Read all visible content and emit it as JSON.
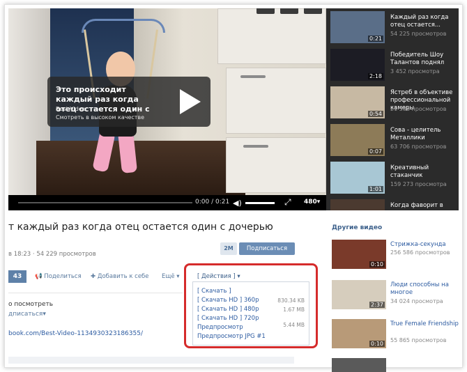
{
  "player": {
    "overlay_title": "Это происходит каждый раз когда отец остается один с",
    "overlay_channel": "Best Video",
    "overlay_hq": "Смотреть в высоком качестве",
    "time": "0:00 / 0:21",
    "quality": "480"
  },
  "playlist": [
    {
      "title": "Каждый раз когда отец остается...",
      "views": "54 225 просмотров",
      "duration": "0:21",
      "color": "#5a6e88"
    },
    {
      "title": "Победитель Шоу Талантов поднял",
      "views": "3 452 просмотра",
      "duration": "2:18",
      "color": "#1c1c24"
    },
    {
      "title": "Ястреб в объективе профессиональной камеры",
      "views": "21 536 просмотров",
      "duration": "0:54",
      "color": "#c7b9a3"
    },
    {
      "title": "Сова - целитель Металлики",
      "views": "63 706 просмотров",
      "duration": "0:07",
      "color": "#8d7b58"
    },
    {
      "title": "Креативный стаканчик",
      "views": "159 273 просмотра",
      "duration": "1:01",
      "color": "#a8c7d4"
    },
    {
      "title": "Когда фаворит в",
      "views": "",
      "duration": "",
      "color": "#4b3a30"
    }
  ],
  "video": {
    "title": "т каждый раз когда отец остается один с дочерью",
    "meta": "в 18:23  ·  54 229 просмотров",
    "subs_count": "2M",
    "subscribe": "Подписаться",
    "likes": "43",
    "share": "Поделиться",
    "add": "Добавить к себе",
    "more": "Ещё",
    "actions": "[ Действия ]",
    "watch_later": "о посмотреть",
    "subscribe_link": "дписаться",
    "link": "book.com/Best-Video-1134930323186355/"
  },
  "actions_menu": [
    {
      "label": "[ Скачать ]",
      "size": ""
    },
    {
      "label": "[ Скачать HD ] 360p",
      "size": "830.34 KB"
    },
    {
      "label": "[ Скачать HD ] 480p",
      "size": "1.67 MB"
    },
    {
      "label": "[ Скачать HD ] 720p",
      "size": ""
    },
    {
      "label": "Предпросмотр",
      "size": "5.44 MB"
    },
    {
      "label": "Предпросмотр JPG #1",
      "size": ""
    }
  ],
  "other": {
    "heading": "Другие видео",
    "items": [
      {
        "title": "Стрижка-секунда",
        "views": "256 586 просмотров",
        "duration": "0:10",
        "color": "#7a3a2a"
      },
      {
        "title": "Люди способны на многое",
        "views": "34 024 просмотра",
        "duration": "2:37",
        "color": "#d6cdbd"
      },
      {
        "title": "True Female Friendship",
        "views": "55 865 просмотров",
        "duration": "0:10",
        "color": "#b89a78"
      }
    ]
  }
}
